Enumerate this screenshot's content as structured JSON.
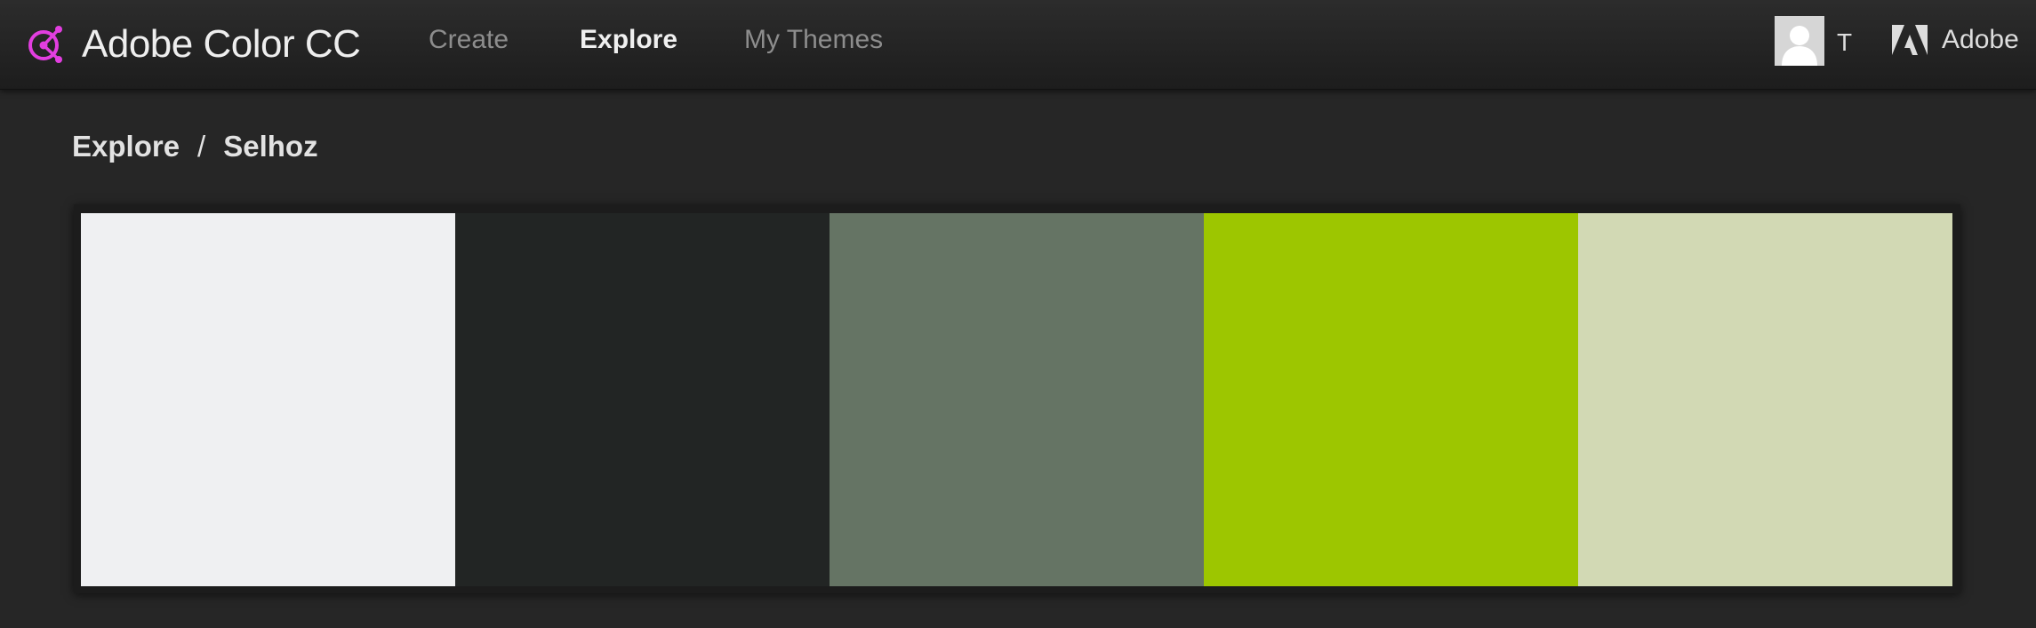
{
  "header": {
    "brand_name": "Adobe Color CC",
    "brand_icon": "adobe-color-wheel-icon",
    "accent_color": "#e23ee0",
    "tabs": [
      {
        "label": "Create",
        "active": false
      },
      {
        "label": "Explore",
        "active": true
      },
      {
        "label": "My Themes",
        "active": false
      }
    ],
    "user": {
      "avatar_icon": "user-silhouette-icon",
      "initial": "T"
    },
    "adobe": {
      "logo_icon": "adobe-logo-icon",
      "label": "Adobe"
    }
  },
  "breadcrumb": {
    "parent": "Explore",
    "separator": "/",
    "current": "Selhoz"
  },
  "theme": {
    "name": "Selhoz",
    "swatches": [
      {
        "color": "#eff0f2"
      },
      {
        "color": "#222524"
      },
      {
        "color": "#657464"
      },
      {
        "color": "#9dc600"
      },
      {
        "color": "#d2d9b4"
      }
    ]
  }
}
